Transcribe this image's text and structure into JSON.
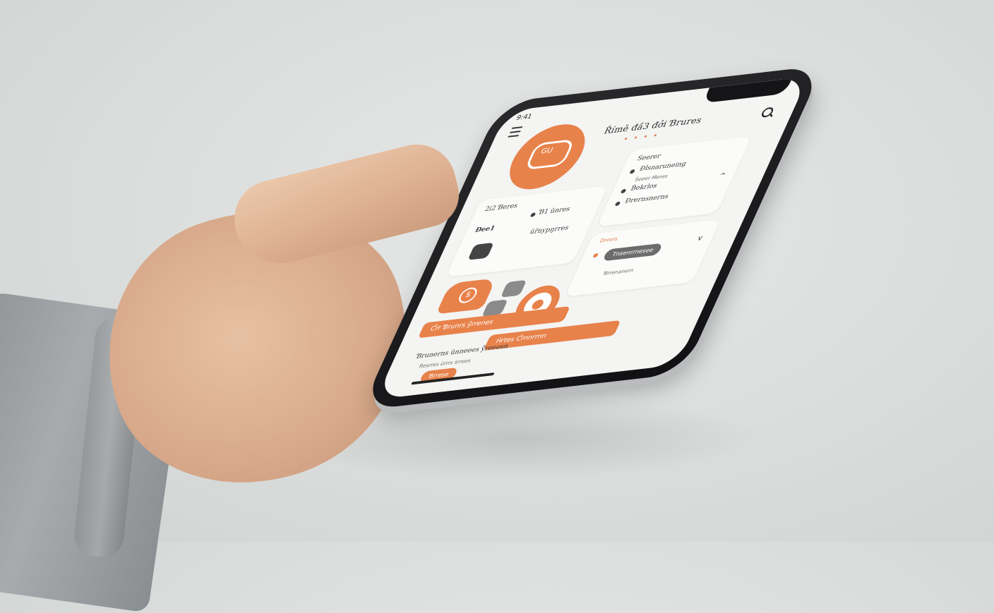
{
  "status": {
    "time": "9:41"
  },
  "header": {
    "title": "Římě đầ3 đởi Ɓrures",
    "page_dots": "• • • •"
  },
  "hero": {
    "label": "GU"
  },
  "cards": {
    "left_top": {
      "title": "2i2 Ɓeres",
      "line1": "Ɓ1 ŭnres",
      "line2": "Đee1",
      "line3": "ŭřnypŋrres"
    },
    "right_top": {
      "title": "Seerer",
      "items": [
        "Đlsnaruneing",
        "Ṡeeer Ṁeres",
        "Ḃekrlos",
        "Đrernsnerns"
      ]
    },
    "right_mid": {
      "label": "Dnrors",
      "pill": "Tnsenrrnesee",
      "small": "Ɓrrenanern"
    }
  },
  "bottom": {
    "orange_bar": "Ƈrr Ɓrunrs ẙrrenes",
    "orange_bar2": "Ḣrtes Ƈrnnrrnn",
    "list_line1": "Ɓrunerns ŭnneees ẙreeesn",
    "list_line2": "Ṙesrres ŭrrrs ṡrrees",
    "button": "Ɓrrese"
  },
  "colors": {
    "accent": "#e8824b",
    "neutral": "#6c6c6c"
  }
}
